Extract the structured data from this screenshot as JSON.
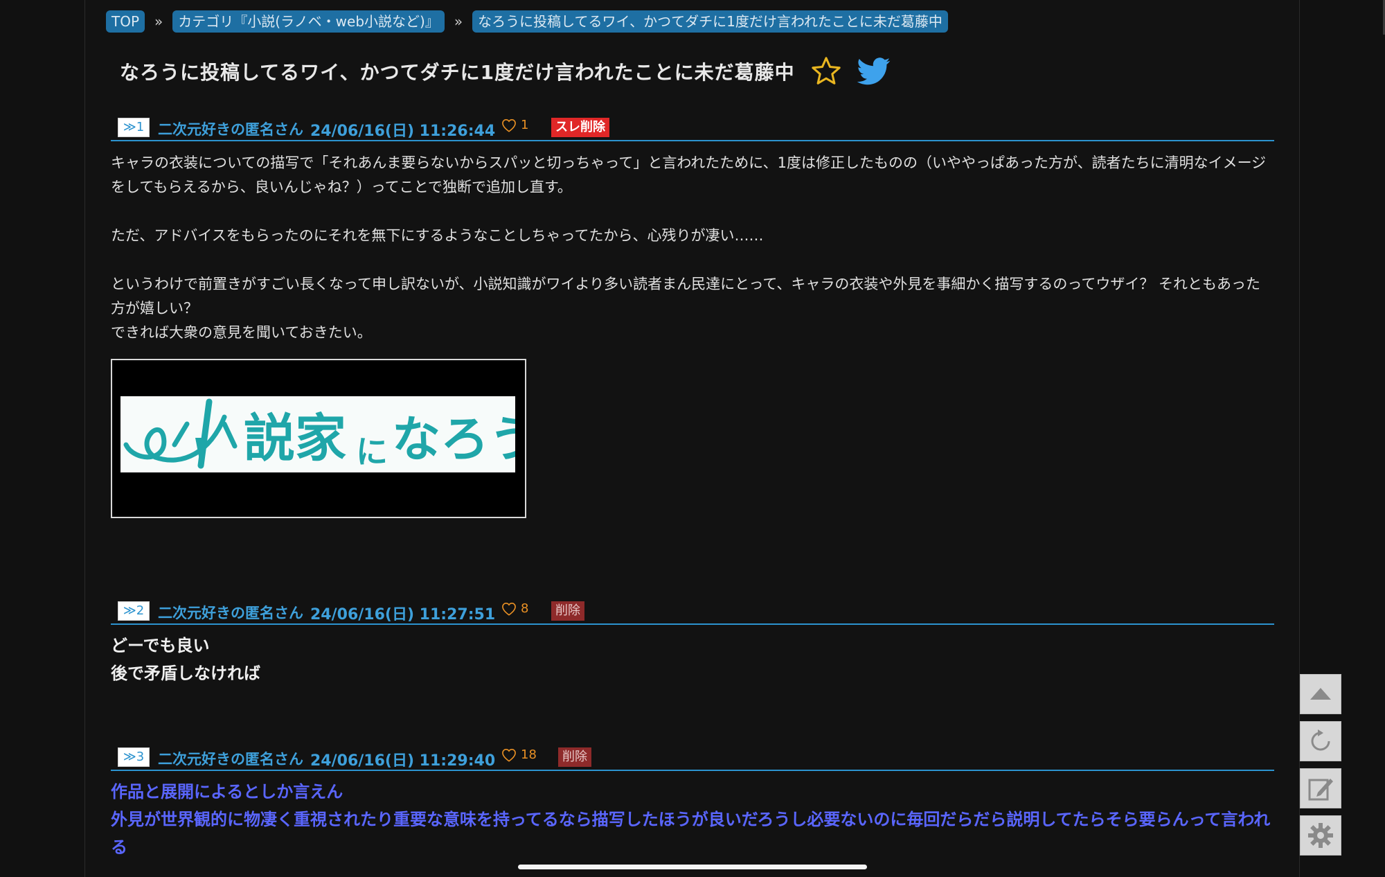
{
  "breadcrumb": {
    "top": "TOP",
    "category": "カテゴリ『小説(ラノベ・web小説など)』",
    "thread": "なろうに投稿してるワイ、かつてダチに1度だけ言われたことに未だ葛藤中",
    "separator": "»"
  },
  "thread": {
    "title": "なろうに投稿してるワイ、かつてダチに1度だけ言われたことに未だ葛藤中"
  },
  "posts": [
    {
      "num": "≫1",
      "author": "二次元好きの匿名さん",
      "date": "24/06/16(日) 11:26:44",
      "likes": "1",
      "delete_label": "スレ削除",
      "paragraphs": [
        "キャラの衣装についての描写で「それあんま要らないからスパッと切っちゃって」と言われたために、1度は修正したものの（いややっぱあった方が、読者たちに清明なイメージをしてもらえるから、良いんじゃね？）ってことで独断で追加し直す。",
        "ただ、アドバイスをもらったのにそれを無下にするようなことしちゃってたから、心残りが凄い……",
        "というわけで前置きがすごい長くなって申し訳ないが、小説知識がワイより多い読者まん民達にとって、キャラの衣装や外見を事細かく描写するのってウザイ？ それともあった方が嬉しい？\nできれば大衆の意見を聞いておきたい。"
      ],
      "image_text": "小説家になろう"
    },
    {
      "num": "≫2",
      "author": "二次元好きの匿名さん",
      "date": "24/06/16(日) 11:27:51",
      "likes": "8",
      "delete_label": "削除",
      "lines": [
        "どーでも良い",
        "後で矛盾しなければ"
      ]
    },
    {
      "num": "≫3",
      "author": "二次元好きの匿名さん",
      "date": "24/06/16(日) 11:29:40",
      "likes": "18",
      "delete_label": "削除",
      "lines": [
        "作品と展開によるとしか言えん",
        "外見が世界観的に物凄く重視されたり重要な意味を持ってるなら描写したほうが良いだろうし必要ないのに毎回だらだら説明してたらそら要らんって言われる"
      ]
    }
  ],
  "colors": {
    "accent": "#2c93cf",
    "author_blue": "#3ea0db",
    "like_orange": "#e99024",
    "delete_red": "#e02727",
    "quote_blue": "#5a66ff"
  },
  "toolbar": {
    "icons": [
      "arrow-up-icon",
      "refresh-icon",
      "edit-icon",
      "gear-icon"
    ]
  }
}
